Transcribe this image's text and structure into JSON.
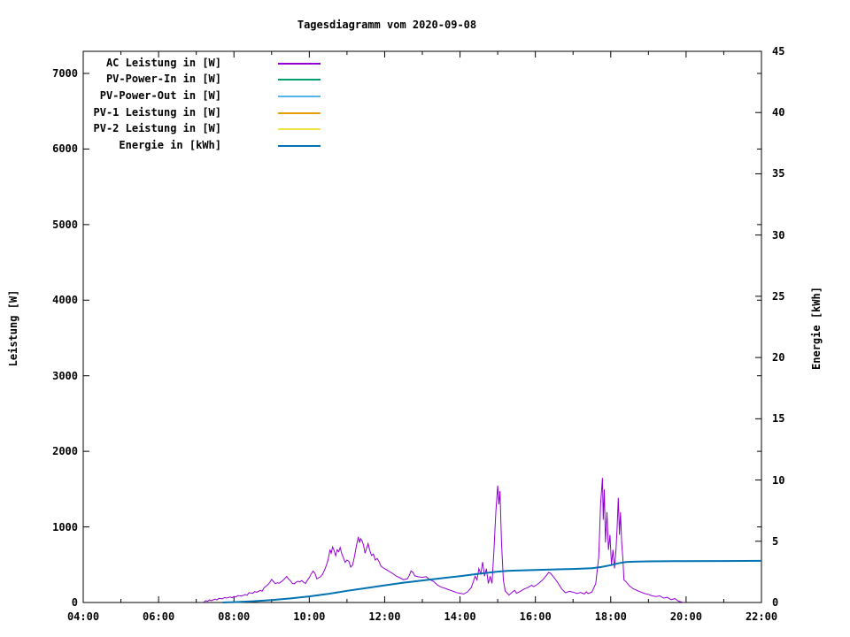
{
  "window": {
    "background": "#ffffff",
    "text_color": "#000000"
  },
  "chart_data": {
    "type": "line",
    "title": "Tagesdiagramm vom 2020-09-08",
    "x_axis": {
      "unit": "time",
      "range_hours": [
        4,
        22
      ],
      "major_tick_labels": [
        "04:00",
        "06:00",
        "08:00",
        "10:00",
        "12:00",
        "14:00",
        "16:00",
        "18:00",
        "20:00",
        "22:00"
      ],
      "major_tick_hours": [
        4,
        6,
        8,
        10,
        12,
        14,
        16,
        18,
        20,
        22
      ],
      "minor_tick_hours": [
        5,
        7,
        9,
        11,
        13,
        15,
        17,
        19,
        21
      ]
    },
    "y_left": {
      "label": "Leistung [W]",
      "tick_values": [
        0,
        1000,
        2000,
        3000,
        4000,
        5000,
        6000,
        7000
      ],
      "tick_labels": [
        "0",
        "1000",
        "2000",
        "3000",
        "4000",
        "5000",
        "6000",
        "7000"
      ],
      "range": [
        0,
        7300
      ]
    },
    "y_right": {
      "label": "Energie [kWh]",
      "tick_values": [
        0,
        5,
        10,
        15,
        20,
        25,
        30,
        35,
        40,
        45
      ],
      "tick_labels": [
        "0",
        "5",
        "10",
        "15",
        "20",
        "25",
        "30",
        "35",
        "40",
        "45"
      ],
      "range": [
        0,
        45
      ]
    },
    "legend": {
      "position": "top-left-inside",
      "entries": [
        {
          "label": "AC Leistung in [W]",
          "color": "#9400d3"
        },
        {
          "label": "PV-Power-In in [W]",
          "color": "#009e73"
        },
        {
          "label": "PV-Power-Out in [W]",
          "color": "#56b4e9"
        },
        {
          "label": "PV-1 Leistung in [W]",
          "color": "#e69f00"
        },
        {
          "label": "PV-2 Leistung in [W]",
          "color": "#f0e442"
        },
        {
          "label": "Energie in [kWh]",
          "color": "#0072b2"
        }
      ]
    },
    "grid": false,
    "series": [
      {
        "name": "AC Leistung in [W]",
        "color": "#9400d3",
        "axis": "left",
        "width": 1,
        "points": [
          [
            7.2,
            5
          ],
          [
            7.25,
            25
          ],
          [
            7.3,
            15
          ],
          [
            7.35,
            35
          ],
          [
            7.4,
            25
          ],
          [
            7.5,
            45
          ],
          [
            7.55,
            35
          ],
          [
            7.6,
            55
          ],
          [
            7.7,
            48
          ],
          [
            7.75,
            65
          ],
          [
            7.8,
            58
          ],
          [
            7.9,
            72
          ],
          [
            7.95,
            62
          ],
          [
            8.0,
            80
          ],
          [
            8.05,
            72
          ],
          [
            8.1,
            92
          ],
          [
            8.2,
            85
          ],
          [
            8.3,
            105
          ],
          [
            8.35,
            95
          ],
          [
            8.4,
            130
          ],
          [
            8.5,
            120
          ],
          [
            8.55,
            145
          ],
          [
            8.6,
            135
          ],
          [
            8.7,
            160
          ],
          [
            8.75,
            150
          ],
          [
            8.8,
            195
          ],
          [
            8.9,
            235
          ],
          [
            8.95,
            265
          ],
          [
            9.0,
            305
          ],
          [
            9.05,
            275
          ],
          [
            9.1,
            248
          ],
          [
            9.15,
            262
          ],
          [
            9.2,
            255
          ],
          [
            9.3,
            292
          ],
          [
            9.35,
            318
          ],
          [
            9.4,
            345
          ],
          [
            9.45,
            310
          ],
          [
            9.5,
            288
          ],
          [
            9.55,
            252
          ],
          [
            9.6,
            248
          ],
          [
            9.65,
            268
          ],
          [
            9.7,
            282
          ],
          [
            9.75,
            272
          ],
          [
            9.8,
            290
          ],
          [
            9.85,
            268
          ],
          [
            9.9,
            252
          ],
          [
            9.95,
            295
          ],
          [
            10.0,
            330
          ],
          [
            10.05,
            378
          ],
          [
            10.1,
            415
          ],
          [
            10.15,
            388
          ],
          [
            10.2,
            312
          ],
          [
            10.25,
            328
          ],
          [
            10.3,
            342
          ],
          [
            10.35,
            372
          ],
          [
            10.4,
            425
          ],
          [
            10.45,
            488
          ],
          [
            10.5,
            565
          ],
          [
            10.55,
            700
          ],
          [
            10.58,
            652
          ],
          [
            10.62,
            735
          ],
          [
            10.66,
            685
          ],
          [
            10.7,
            618
          ],
          [
            10.74,
            698
          ],
          [
            10.78,
            672
          ],
          [
            10.82,
            728
          ],
          [
            10.86,
            648
          ],
          [
            10.9,
            598
          ],
          [
            10.95,
            532
          ],
          [
            11.0,
            562
          ],
          [
            11.05,
            545
          ],
          [
            11.1,
            468
          ],
          [
            11.15,
            498
          ],
          [
            11.2,
            612
          ],
          [
            11.25,
            748
          ],
          [
            11.3,
            868
          ],
          [
            11.33,
            792
          ],
          [
            11.36,
            845
          ],
          [
            11.4,
            815
          ],
          [
            11.44,
            758
          ],
          [
            11.48,
            652
          ],
          [
            11.52,
            718
          ],
          [
            11.56,
            778
          ],
          [
            11.6,
            698
          ],
          [
            11.65,
            622
          ],
          [
            11.7,
            642
          ],
          [
            11.75,
            562
          ],
          [
            11.8,
            582
          ],
          [
            11.85,
            542
          ],
          [
            11.9,
            482
          ],
          [
            11.95,
            462
          ],
          [
            12.0,
            448
          ],
          [
            12.1,
            418
          ],
          [
            12.2,
            388
          ],
          [
            12.3,
            352
          ],
          [
            12.4,
            328
          ],
          [
            12.5,
            302
          ],
          [
            12.6,
            312
          ],
          [
            12.65,
            355
          ],
          [
            12.7,
            418
          ],
          [
            12.75,
            398
          ],
          [
            12.8,
            352
          ],
          [
            12.9,
            340
          ],
          [
            13.0,
            332
          ],
          [
            13.1,
            342
          ],
          [
            13.2,
            302
          ],
          [
            13.3,
            278
          ],
          [
            13.4,
            232
          ],
          [
            13.5,
            202
          ],
          [
            13.6,
            188
          ],
          [
            13.7,
            168
          ],
          [
            13.8,
            152
          ],
          [
            13.9,
            132
          ],
          [
            14.0,
            122
          ],
          [
            14.1,
            112
          ],
          [
            14.2,
            142
          ],
          [
            14.3,
            198
          ],
          [
            14.4,
            348
          ],
          [
            14.45,
            298
          ],
          [
            14.5,
            448
          ],
          [
            14.55,
            378
          ],
          [
            14.6,
            535
          ],
          [
            14.65,
            348
          ],
          [
            14.7,
            448
          ],
          [
            14.75,
            252
          ],
          [
            14.8,
            348
          ],
          [
            14.85,
            252
          ],
          [
            14.9,
            695
          ],
          [
            14.95,
            1195
          ],
          [
            15.0,
            1548
          ],
          [
            15.03,
            1298
          ],
          [
            15.06,
            1475
          ],
          [
            15.1,
            795
          ],
          [
            15.15,
            295
          ],
          [
            15.2,
            152
          ],
          [
            15.3,
            98
          ],
          [
            15.4,
            142
          ],
          [
            15.45,
            162
          ],
          [
            15.5,
            122
          ],
          [
            15.6,
            148
          ],
          [
            15.7,
            178
          ],
          [
            15.8,
            198
          ],
          [
            15.9,
            228
          ],
          [
            15.95,
            208
          ],
          [
            16.0,
            222
          ],
          [
            16.1,
            258
          ],
          [
            16.2,
            302
          ],
          [
            16.3,
            362
          ],
          [
            16.35,
            398
          ],
          [
            16.4,
            388
          ],
          [
            16.5,
            328
          ],
          [
            16.6,
            258
          ],
          [
            16.7,
            178
          ],
          [
            16.8,
            128
          ],
          [
            16.9,
            148
          ],
          [
            17.0,
            138
          ],
          [
            17.1,
            118
          ],
          [
            17.2,
            132
          ],
          [
            17.3,
            112
          ],
          [
            17.35,
            142
          ],
          [
            17.4,
            118
          ],
          [
            17.5,
            138
          ],
          [
            17.6,
            248
          ],
          [
            17.68,
            598
          ],
          [
            17.73,
            1295
          ],
          [
            17.78,
            1648
          ],
          [
            17.8,
            1095
          ],
          [
            17.83,
            1495
          ],
          [
            17.86,
            795
          ],
          [
            17.9,
            1195
          ],
          [
            17.94,
            695
          ],
          [
            17.98,
            895
          ],
          [
            18.02,
            498
          ],
          [
            18.06,
            695
          ],
          [
            18.1,
            452
          ],
          [
            18.14,
            695
          ],
          [
            18.17,
            995
          ],
          [
            18.2,
            1385
          ],
          [
            18.23,
            895
          ],
          [
            18.26,
            1195
          ],
          [
            18.29,
            795
          ],
          [
            18.32,
            598
          ],
          [
            18.35,
            298
          ],
          [
            18.4,
            278
          ],
          [
            18.5,
            218
          ],
          [
            18.6,
            182
          ],
          [
            18.7,
            158
          ],
          [
            18.8,
            138
          ],
          [
            18.9,
            118
          ],
          [
            19.0,
            108
          ],
          [
            19.1,
            88
          ],
          [
            19.2,
            78
          ],
          [
            19.3,
            88
          ],
          [
            19.4,
            58
          ],
          [
            19.5,
            68
          ],
          [
            19.6,
            38
          ],
          [
            19.7,
            52
          ],
          [
            19.8,
            18
          ],
          [
            19.9,
            5
          ]
        ]
      },
      {
        "name": "PV-Power-In in [W]",
        "color": "#009e73",
        "axis": "left",
        "width": 1,
        "points": []
      },
      {
        "name": "PV-Power-Out in [W]",
        "color": "#56b4e9",
        "axis": "left",
        "width": 1,
        "points": []
      },
      {
        "name": "PV-1 Leistung in [W]",
        "color": "#e69f00",
        "axis": "left",
        "width": 1,
        "points": []
      },
      {
        "name": "PV-2 Leistung in [W]",
        "color": "#f0e442",
        "axis": "left",
        "width": 1,
        "points": []
      },
      {
        "name": "Energie in [kWh]",
        "color": "#0072b2",
        "axis": "right",
        "width": 2,
        "points": [
          [
            7.7,
            0
          ],
          [
            8.0,
            0.03
          ],
          [
            8.5,
            0.1
          ],
          [
            9.0,
            0.2
          ],
          [
            9.5,
            0.33
          ],
          [
            10.0,
            0.5
          ],
          [
            10.5,
            0.7
          ],
          [
            11.0,
            0.95
          ],
          [
            11.5,
            1.18
          ],
          [
            12.0,
            1.4
          ],
          [
            12.5,
            1.62
          ],
          [
            13.0,
            1.8
          ],
          [
            13.5,
            1.98
          ],
          [
            14.0,
            2.15
          ],
          [
            14.5,
            2.35
          ],
          [
            15.0,
            2.52
          ],
          [
            15.25,
            2.58
          ],
          [
            15.5,
            2.61
          ],
          [
            16.0,
            2.65
          ],
          [
            16.5,
            2.7
          ],
          [
            17.0,
            2.74
          ],
          [
            17.5,
            2.8
          ],
          [
            17.75,
            2.9
          ],
          [
            18.0,
            3.05
          ],
          [
            18.2,
            3.2
          ],
          [
            18.4,
            3.3
          ],
          [
            18.6,
            3.33
          ],
          [
            19.0,
            3.36
          ],
          [
            20.0,
            3.38
          ],
          [
            21.0,
            3.39
          ],
          [
            22.0,
            3.4
          ]
        ]
      }
    ]
  }
}
